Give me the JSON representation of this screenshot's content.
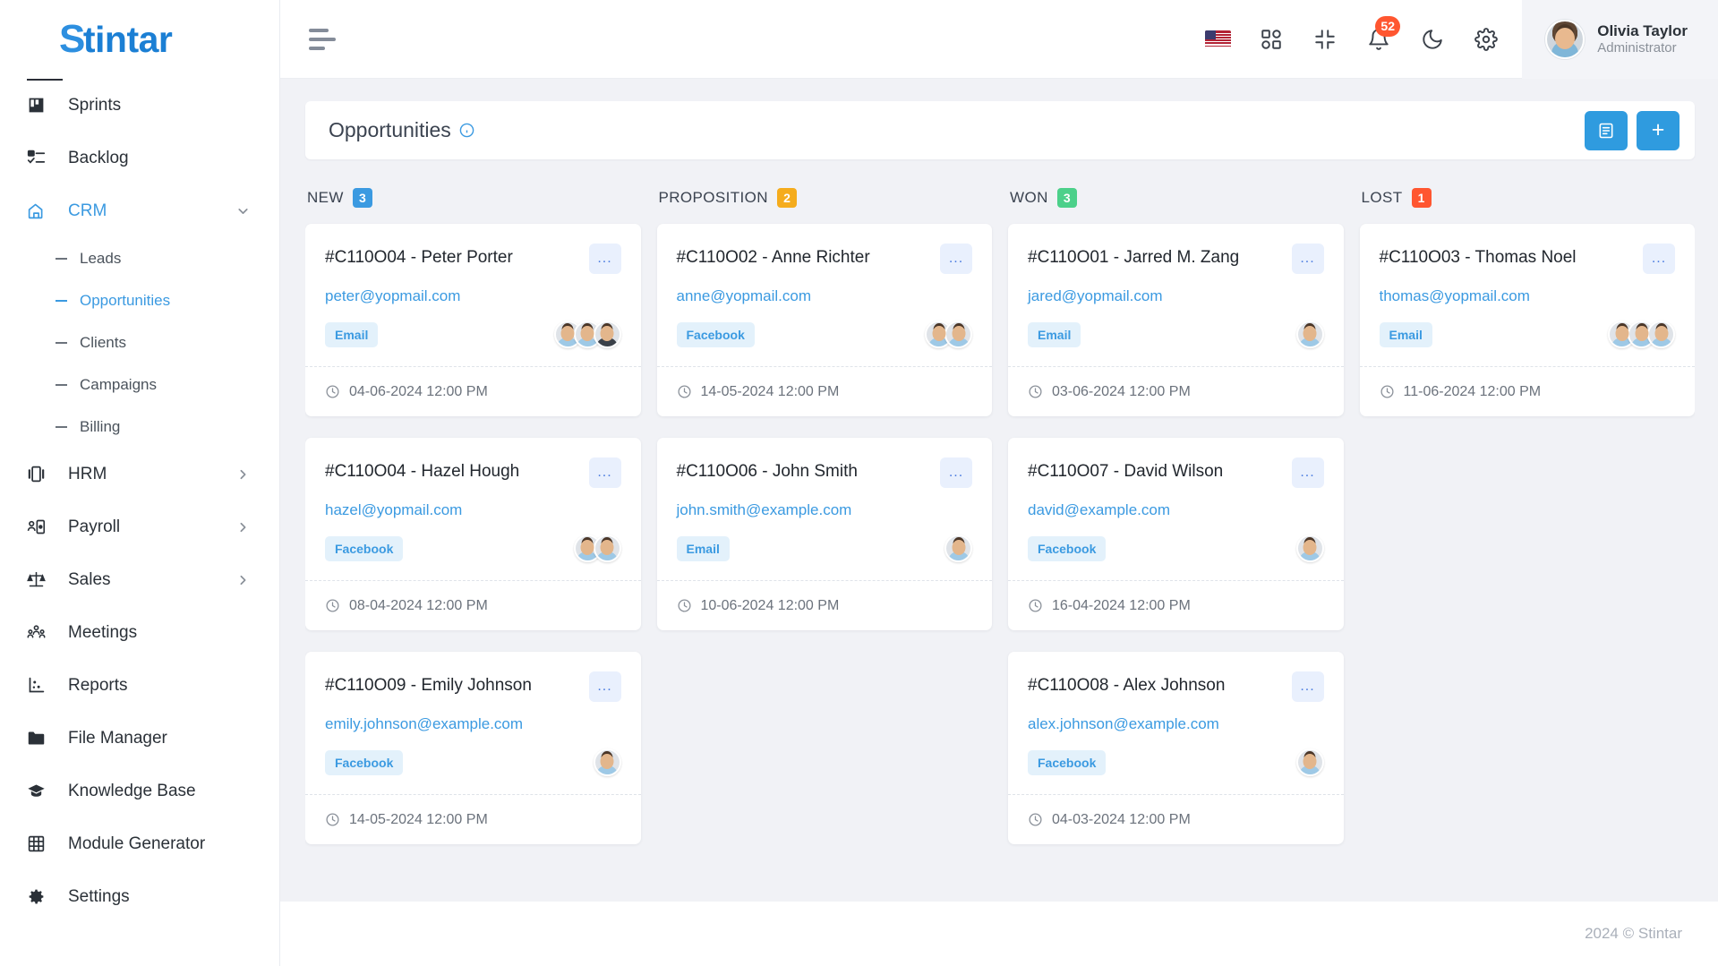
{
  "brand": {
    "name": "Stintar",
    "first_letter": "S",
    "rest": "tintar"
  },
  "sidebar": {
    "items": [
      {
        "label": "Sprints",
        "icon": "kanban-icon",
        "active": false,
        "chevron": ""
      },
      {
        "label": "Backlog",
        "icon": "checklist-icon",
        "active": false,
        "chevron": ""
      },
      {
        "label": "CRM",
        "icon": "crm-icon",
        "active": true,
        "chevron": "down"
      }
    ],
    "crm_sub_items": [
      {
        "label": "Leads",
        "active": false
      },
      {
        "label": "Opportunities",
        "active": true
      },
      {
        "label": "Clients",
        "active": false
      },
      {
        "label": "Campaigns",
        "active": false
      },
      {
        "label": "Billing",
        "active": false
      }
    ],
    "items_after": [
      {
        "label": "HRM",
        "icon": "hrm-icon",
        "active": false,
        "chevron": "right"
      },
      {
        "label": "Payroll",
        "icon": "payroll-icon",
        "active": false,
        "chevron": "right"
      },
      {
        "label": "Sales",
        "icon": "scale-icon",
        "active": false,
        "chevron": "right"
      },
      {
        "label": "Meetings",
        "icon": "people-icon",
        "active": false,
        "chevron": ""
      },
      {
        "label": "Reports",
        "icon": "chart-icon",
        "active": false,
        "chevron": ""
      },
      {
        "label": "File Manager",
        "icon": "folder-icon",
        "active": false,
        "chevron": ""
      },
      {
        "label": "Knowledge Base",
        "icon": "graduation-cap-icon",
        "active": false,
        "chevron": ""
      },
      {
        "label": "Module Generator",
        "icon": "grid-table-icon",
        "active": false,
        "chevron": ""
      },
      {
        "label": "Settings",
        "icon": "gear-icon",
        "active": false,
        "chevron": ""
      }
    ]
  },
  "topbar": {
    "menu_toggle": "hamburger-icon",
    "language_flag": "us-flag-icon",
    "apps_icon": "apps-grid-icon",
    "fullscreen_icon": "compress-icon",
    "notifications_icon": "bell-icon",
    "notifications_count": "52",
    "theme_icon": "moon-icon",
    "settings_icon": "gear-icon",
    "user": {
      "name": "Olivia Taylor",
      "role": "Administrator",
      "avatar": "user-avatar"
    }
  },
  "page": {
    "title": "Opportunities",
    "info_icon": "info-circle-icon",
    "list_view_icon": "list-view-icon",
    "add_label": "+",
    "menu_dots": "..."
  },
  "board": {
    "columns": [
      {
        "name": "NEW",
        "count": "3",
        "color": "#3b9ae1",
        "cards": [
          {
            "title": "#C110O04 - Peter Porter",
            "email": "peter@yopmail.com",
            "tag": "Email",
            "date": "04-06-2024 12:00 PM",
            "avatars": 3
          },
          {
            "title": "#C110O04 - Hazel Hough",
            "email": "hazel@yopmail.com",
            "tag": "Facebook",
            "date": "08-04-2024 12:00 PM",
            "avatars": 2
          },
          {
            "title": "#C110O09 - Emily Johnson",
            "email": "emily.johnson@example.com",
            "tag": "Facebook",
            "date": "14-05-2024 12:00 PM",
            "avatars": 1
          }
        ]
      },
      {
        "name": "PROPOSITION",
        "count": "2",
        "color": "#f5ac1d",
        "cards": [
          {
            "title": "#C110O02 - Anne Richter",
            "email": "anne@yopmail.com",
            "tag": "Facebook",
            "date": "14-05-2024 12:00 PM",
            "avatars": 2
          },
          {
            "title": "#C110O06 - John Smith",
            "email": "john.smith@example.com",
            "tag": "Email",
            "date": "10-06-2024 12:00 PM",
            "avatars": 1
          }
        ]
      },
      {
        "name": "WON",
        "count": "3",
        "color": "#4cd08a",
        "cards": [
          {
            "title": "#C110O01 - Jarred M. Zang",
            "email": "jared@yopmail.com",
            "tag": "Email",
            "date": "03-06-2024 12:00 PM",
            "avatars": 1
          },
          {
            "title": "#C110O07 - David Wilson",
            "email": "david@example.com",
            "tag": "Facebook",
            "date": "16-04-2024 12:00 PM",
            "avatars": 1
          },
          {
            "title": "#C110O08 - Alex Johnson",
            "email": "alex.johnson@example.com",
            "tag": "Facebook",
            "date": "04-03-2024 12:00 PM",
            "avatars": 1
          }
        ]
      },
      {
        "name": "LOST",
        "count": "1",
        "color": "#ff5630",
        "cards": [
          {
            "title": "#C110O03 - Thomas Noel",
            "email": "thomas@yopmail.com",
            "tag": "Email",
            "date": "11-06-2024 12:00 PM",
            "avatars": 3
          }
        ]
      }
    ]
  },
  "footer": {
    "copyright": "2024 © Stintar"
  }
}
